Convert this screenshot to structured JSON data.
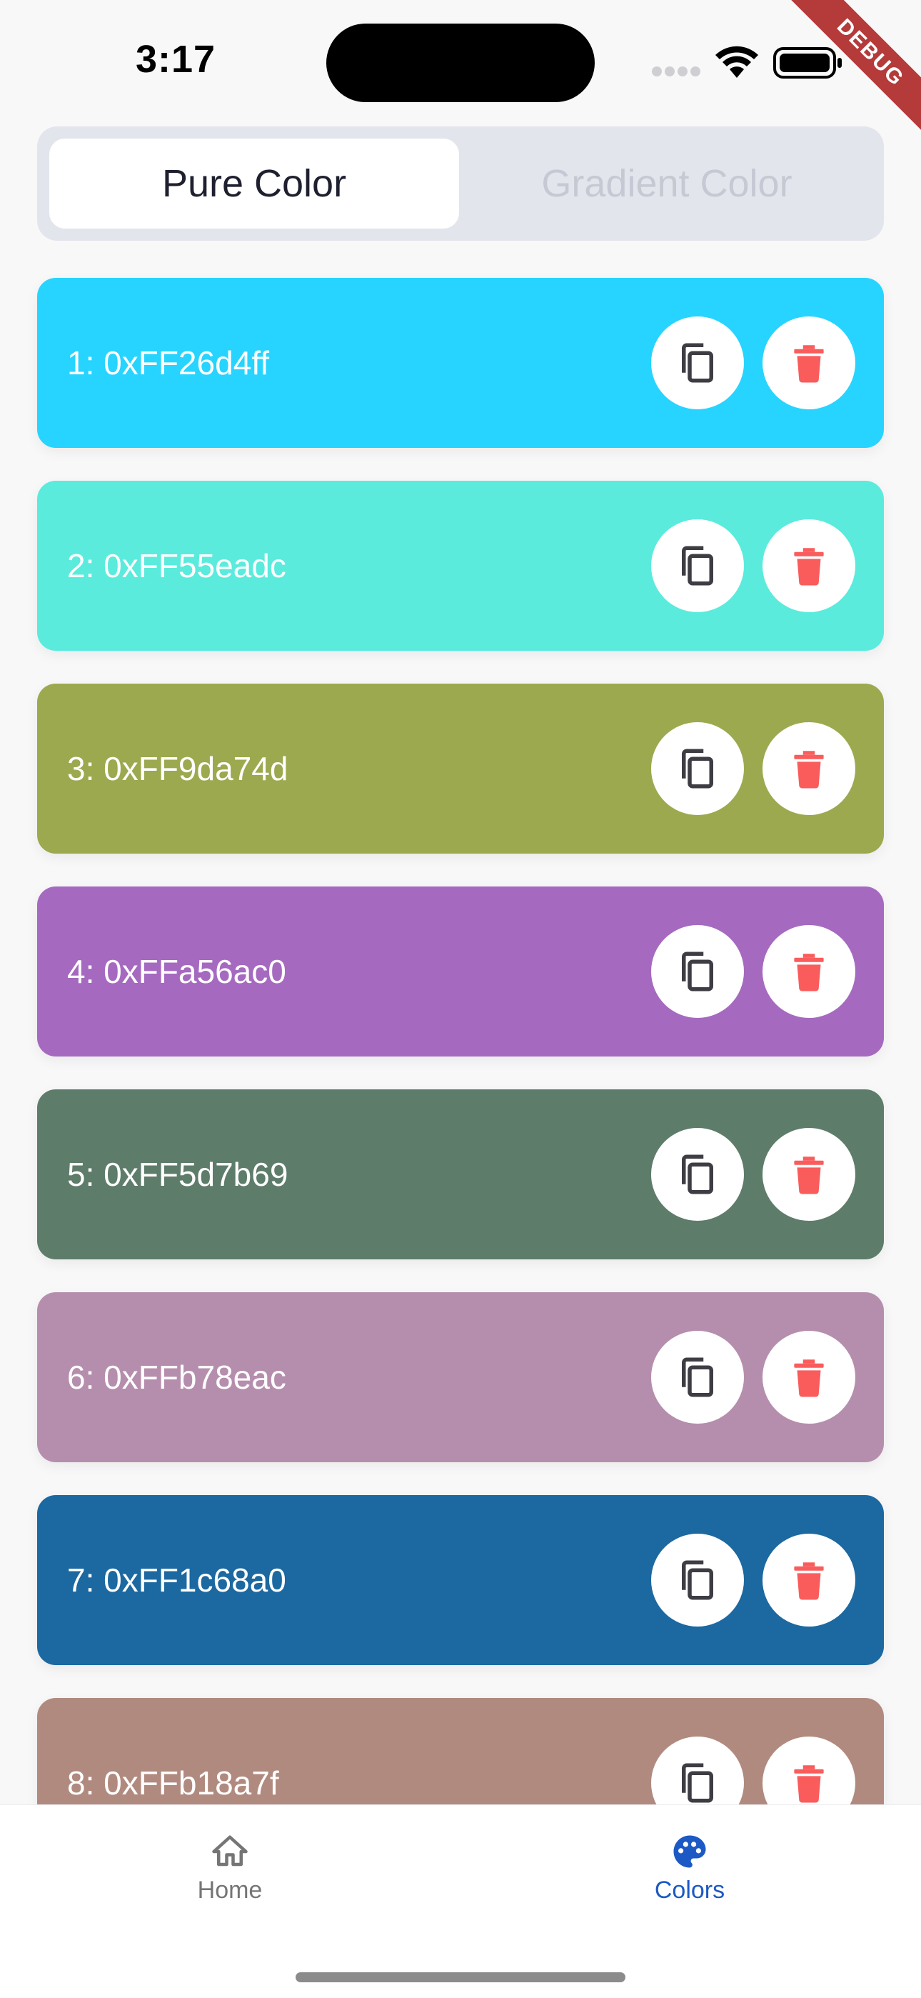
{
  "status_bar": {
    "time": "3:17",
    "debug_label": "DEBUG"
  },
  "segmented": {
    "tabs": [
      {
        "label": "Pure Color",
        "active": true
      },
      {
        "label": "Gradient Color",
        "active": false
      }
    ]
  },
  "colors": [
    {
      "label": "1: 0xFF26d4ff",
      "color": "#26d4ff"
    },
    {
      "label": "2: 0xFF55eadc",
      "color": "#5aebdd"
    },
    {
      "label": "3: 0xFF9da74d",
      "color": "#9da94f"
    },
    {
      "label": "4: 0xFFa56ac0",
      "color": "#a56ac0"
    },
    {
      "label": "5: 0xFF5d7b69",
      "color": "#5e7c6a"
    },
    {
      "label": "6: 0xFFb78eac",
      "color": "#b68ead"
    },
    {
      "label": "7: 0xFF1c68a0",
      "color": "#1c68a0"
    },
    {
      "label": "8: 0xFFb18a7f",
      "color": "#b18a7f"
    }
  ],
  "icons": {
    "copy": "copy-icon",
    "delete": "trash-icon",
    "delete_color": "#fa5c5c",
    "copy_color": "#3d3d43"
  },
  "bottom_nav": {
    "items": [
      {
        "label": "Home",
        "icon": "home-icon",
        "active": false
      },
      {
        "label": "Colors",
        "icon": "palette-icon",
        "active": true
      }
    ],
    "active_color": "#1c59c4"
  }
}
